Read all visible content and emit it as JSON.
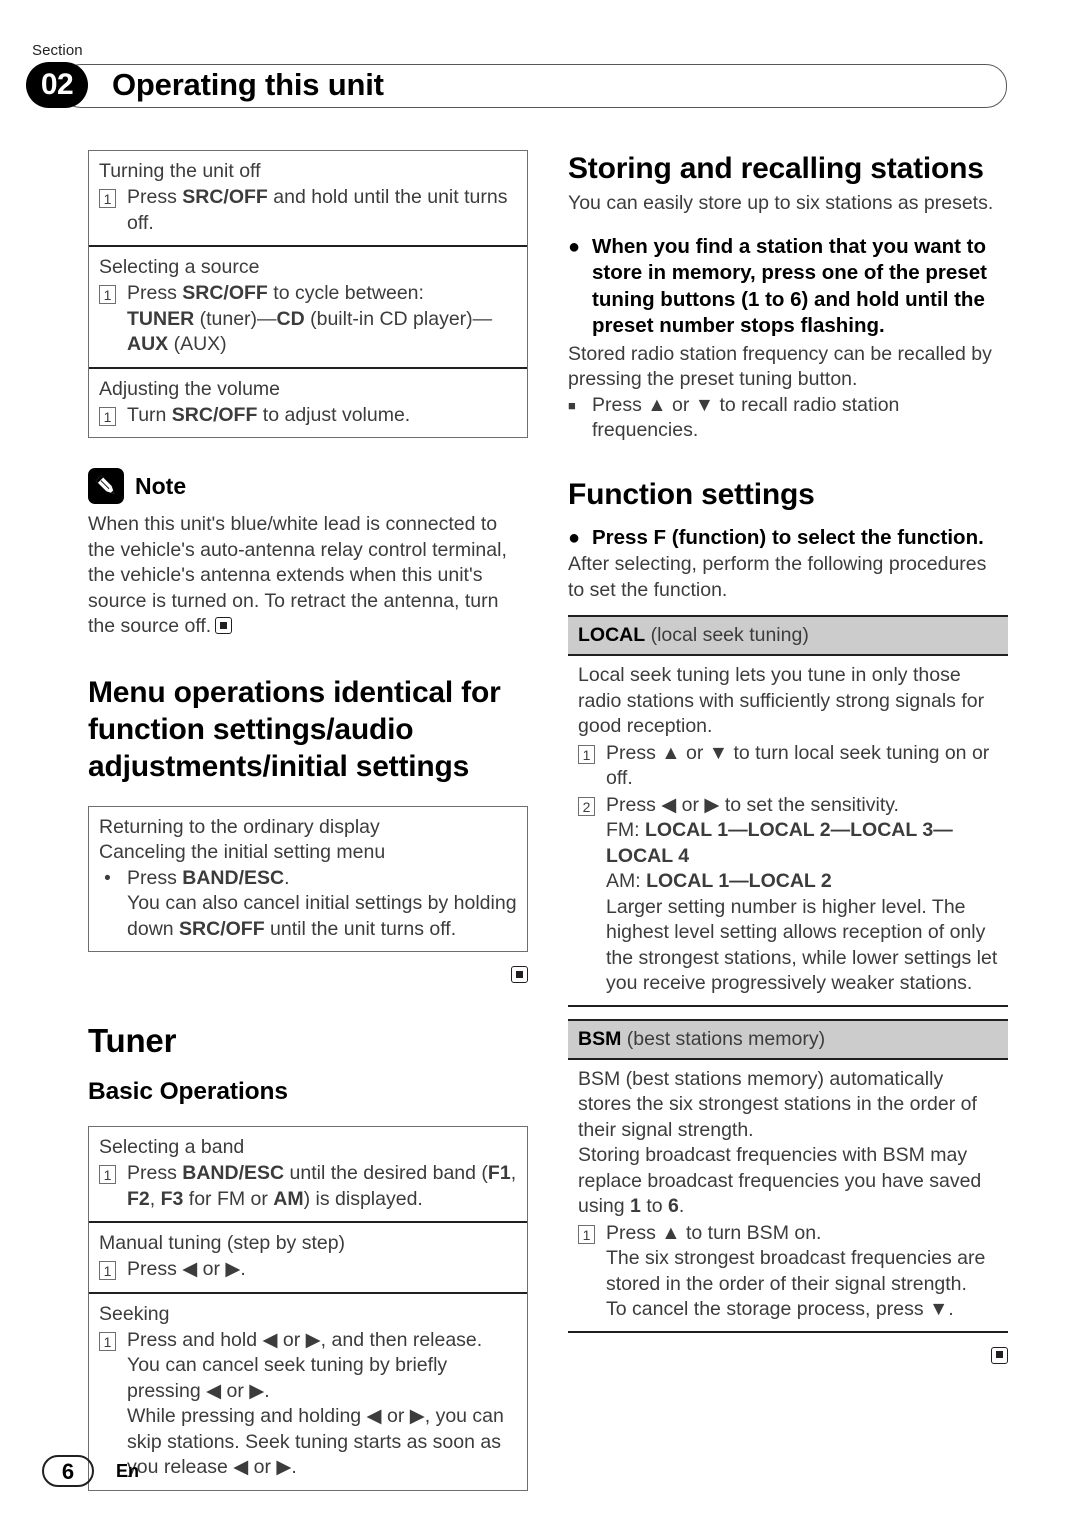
{
  "header": {
    "section_word": "Section",
    "section_number": "02",
    "title": "Operating this unit"
  },
  "left_column": {
    "basic_ops_table": [
      {
        "title": "Turning the unit off",
        "marker": "1",
        "step_html": "Press <b>SRC/OFF</b> and hold until the unit turns off."
      },
      {
        "title": "Selecting a source",
        "marker": "1",
        "step_html": "Press <b>SRC/OFF</b> to cycle between:<span class=\"indent\"><b>TUNER</b> (tuner)—<b>CD</b> (built-in CD player)—<b>AUX</b> (AUX)</span>"
      },
      {
        "title": "Adjusting the volume",
        "marker": "1",
        "step_html": "Turn <b>SRC/OFF</b> to adjust volume."
      }
    ],
    "note": {
      "icon": "pencil-icon",
      "label": "Note",
      "text": "When this unit's blue/white lead is connected to the vehicle's auto-antenna relay control terminal, the vehicle's antenna extends when this unit's source is turned on. To retract the antenna, turn the source off."
    },
    "menu_heading": "Menu operations identical for function settings/audio adjustments/initial settings",
    "menu_table": [
      {
        "title_line1": "Returning to the ordinary display",
        "title_line2": "Canceling the initial setting menu",
        "marker": "•",
        "step_html": "Press <b>BAND/ESC</b>.<span class=\"indent\">You can also cancel initial settings by holding down <b>SRC/OFF</b> until the unit turns off.</span>"
      }
    ],
    "tuner_heading": "Tuner",
    "basic_operations_heading": "Basic Operations",
    "tuner_table": [
      {
        "title": "Selecting a band",
        "marker": "1",
        "step_html": "Press <b>BAND/ESC</b> until the desired band (<b>F1</b>, <b>F2</b>, <b>F3</b> for FM or <b>AM</b>) is displayed."
      },
      {
        "title": "Manual tuning (step by step)",
        "marker": "1",
        "step_html": "Press ◀ or ▶."
      },
      {
        "title": "Seeking",
        "marker": "1",
        "step_html": "Press and hold ◀ or ▶, and then release.<span class=\"indent\">You can cancel seek tuning by briefly pressing ◀ or ▶.</span><span class=\"indent\">While pressing and holding ◀ or ▶, you can skip stations. Seek tuning starts as soon as you release ◀ or ▶.</span>"
      }
    ]
  },
  "right_column": {
    "storing_heading": "Storing and recalling stations",
    "storing_intro": "You can easily store up to six stations as presets.",
    "storing_bullet": "When you find a station that you want to store in memory, press one of the preset tuning buttons (1 to 6) and hold until the preset number stops flashing.",
    "storing_body": "Stored radio station frequency can be recalled by pressing the preset tuning button.",
    "storing_sub": "Press ▲ or ▼ to recall radio station frequencies.",
    "function_heading": "Function settings",
    "function_bullet": "Press F (function) to select the function.",
    "function_body": "After selecting, perform the following procedures to set the function.",
    "functions": [
      {
        "head_code": "LOCAL",
        "head_desc": "(local seek tuning)",
        "intro": "Local seek tuning lets you tune in only those radio stations with sufficiently strong signals for good reception.",
        "steps": [
          {
            "marker": "1",
            "html": "Press ▲ or ▼ to turn local seek tuning on or off."
          },
          {
            "marker": "2",
            "html": "Press ◀ or ▶ to set the sensitivity.<span class=\"indent\">FM: <b>LOCAL 1—LOCAL 2—LOCAL 3—LOCAL 4</b></span><span class=\"indent\">AM: <b>LOCAL 1—LOCAL 2</b></span><span class=\"indent\">Larger setting number is higher level. The highest level setting allows reception of only the strongest stations, while lower settings let you receive progressively weaker stations.</span>"
          }
        ]
      },
      {
        "head_code": "BSM",
        "head_desc": "(best stations memory)",
        "intro": "BSM (best stations memory) automatically stores the six strongest stations in the order of their signal strength.",
        "intro2_html": "Storing broadcast frequencies with BSM may replace broadcast frequencies you have saved using <b>1</b> to <b>6</b>.",
        "steps": [
          {
            "marker": "1",
            "html": "Press ▲ to turn BSM on.<span class=\"indent\">The six strongest broadcast frequencies are stored in the order of their signal strength.</span><span class=\"indent\">To cancel the storage process, press ▼.</span>"
          }
        ]
      }
    ]
  },
  "footer": {
    "page_number": "6",
    "language": "En"
  },
  "colors": {
    "text": "#3c3c3c",
    "bold_text": "#000000",
    "rule": "#231f20",
    "table_border": "#6d6e71",
    "fn_head_bg": "#cccccc"
  }
}
